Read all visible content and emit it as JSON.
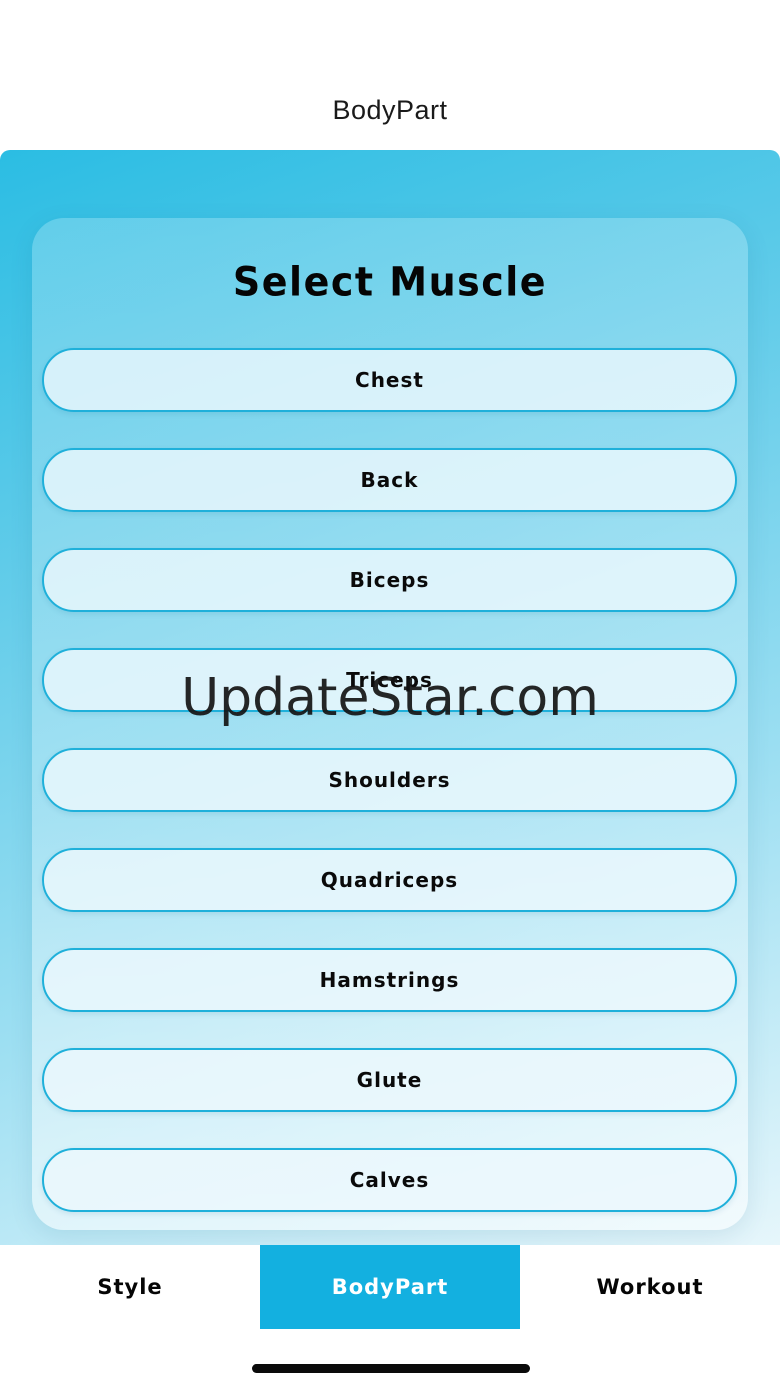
{
  "nav": {
    "title": "BodyPart"
  },
  "panel": {
    "title": "Select Muscle",
    "muscles": [
      "Chest",
      "Back",
      "Biceps",
      "Triceps",
      "Shoulders",
      "Quadriceps",
      "Hamstrings",
      "Glute",
      "Calves"
    ]
  },
  "watermark": "UpdateStar.com",
  "tabs": [
    {
      "label": "Style",
      "active": false
    },
    {
      "label": "BodyPart",
      "active": true
    },
    {
      "label": "Workout",
      "active": false
    }
  ],
  "colors": {
    "accent": "#13b0e0",
    "button_border": "#1fb0da"
  }
}
